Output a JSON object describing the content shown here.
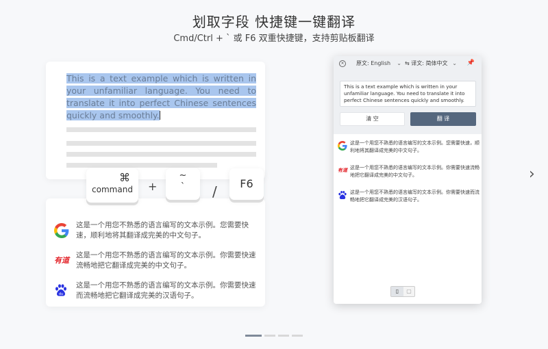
{
  "header": {
    "title": "划取字段 快捷键一键翻译",
    "subtitle": "Cmd/Ctrl + ` 或 F6 双重快捷键，支持剪贴板翻译"
  },
  "doc": {
    "selected_text": "This is a text example which is written in your unfamiliar language. You need to translate it into perfect Chinese sentences quickly and smoothly."
  },
  "keys": {
    "cmd_symbol": "⌘",
    "cmd_label": "command",
    "plus": "+",
    "tilde_top": "~",
    "tilde_bottom": "`",
    "slash": "/",
    "f6_label": "F6"
  },
  "left_results": [
    {
      "engine_icon": "google-icon",
      "text": "这是一个用您不熟悉的语言编写的文本示例。您需要快速，顺利地将其翻译成完美的中文句子。"
    },
    {
      "engine_icon": "youdao-icon",
      "logo_text": "有道",
      "text": "这是一个用您不熟悉的语言编写的文本示例。你需要快速流畅地把它翻译成完美的中文句子。"
    },
    {
      "engine_icon": "baidu-icon",
      "text": "这是一个用您不熟悉的语言编写的文本示例。你需要快速而流畅地把它翻译成完美的汉语句子。"
    }
  ],
  "app": {
    "source_lang": "原文: English",
    "target_lang": "译文: 简体中文",
    "swap_symbol": "⇆",
    "source_text": "This is a text example which is written in your unfamiliar language. You need to translate it into perfect Chinese sentences quickly and smoothly.",
    "clear_label": "清 空",
    "translate_label": "翻 译",
    "results": [
      {
        "engine_icon": "google-icon",
        "text": "这是一个用您不熟悉的语言编写的文本示例。您需要快速，顺利地将其翻译成完美的中文句子。"
      },
      {
        "engine_icon": "youdao-icon",
        "logo_text": "有道",
        "text": "这是一个用您不熟悉的语言编写的文本示例。你需要快速流畅地把它翻译成完美的中文句子。"
      },
      {
        "engine_icon": "baidu-icon",
        "text": "这是一个用您不熟悉的语言编写的文本示例。你需要快速而流畅地把它翻译成完美的汉语句子。"
      }
    ]
  },
  "carousel": {
    "next_arrow": "›",
    "dot_count": 4,
    "active_index": 0
  },
  "colors": {
    "accent": "#55677e",
    "highlight": "#a9c6ee",
    "google_blue": "#4285F4",
    "google_red": "#EA4335",
    "google_yellow": "#FBBC05",
    "google_green": "#34A853",
    "youdao_red": "#e3262c",
    "baidu_blue": "#2932e1"
  }
}
